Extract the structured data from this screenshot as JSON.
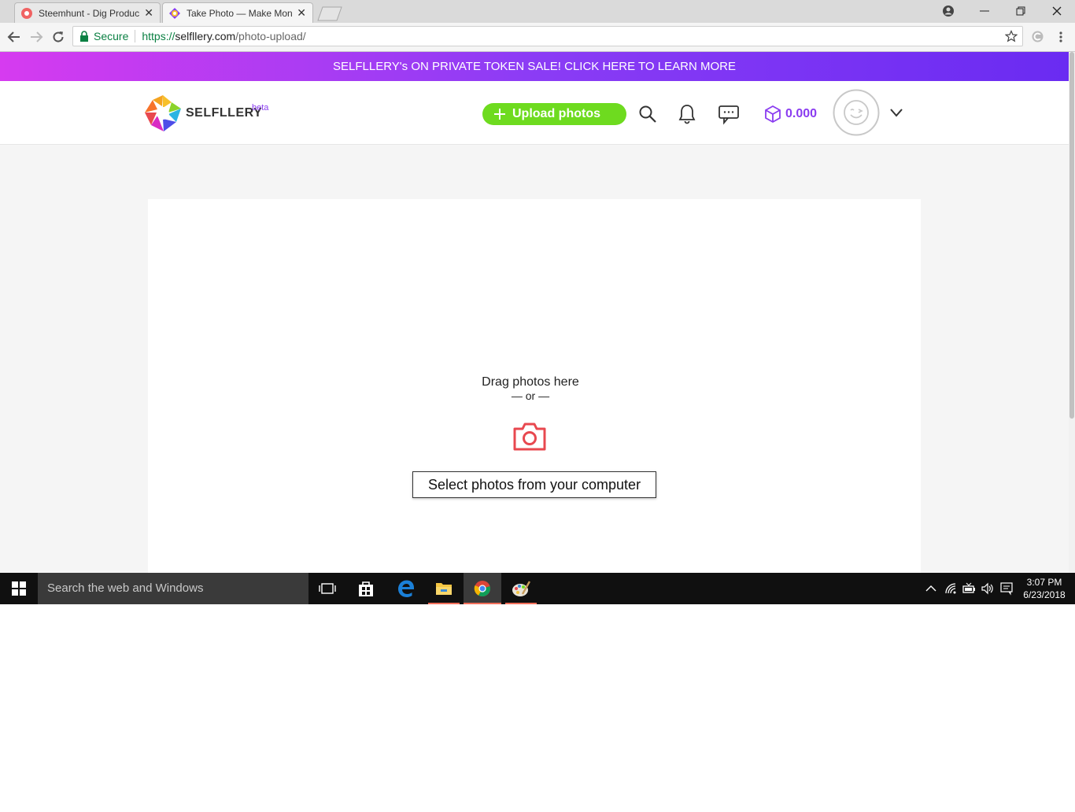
{
  "browser": {
    "tabs": [
      {
        "title": "Steemhunt - Dig Product",
        "close": "✕"
      },
      {
        "title": "Take Photo — Make Mon",
        "close": "✕"
      }
    ],
    "secure_label": "Secure",
    "url_scheme": "https://",
    "url_host": "selfllery.com",
    "url_path": "/photo-upload/"
  },
  "promo_banner": "SELFLLERY's ON PRIVATE TOKEN SALE! CLICK HERE TO LEARN MORE",
  "header": {
    "logo_text": "SELFLLERY",
    "beta": "beta",
    "upload_button": "Upload photos",
    "balance": "0.000"
  },
  "upload": {
    "drag_text": "Drag photos here",
    "or_text": "— or —",
    "select_button": "Select photos from your computer"
  },
  "taskbar": {
    "search_placeholder": "Search the web and Windows",
    "time": "3:07 PM",
    "date": "6/23/2018"
  },
  "colors": {
    "accent_green": "#6edb1f",
    "accent_purple": "#8a3cf0",
    "camera_red": "#e8484f"
  }
}
